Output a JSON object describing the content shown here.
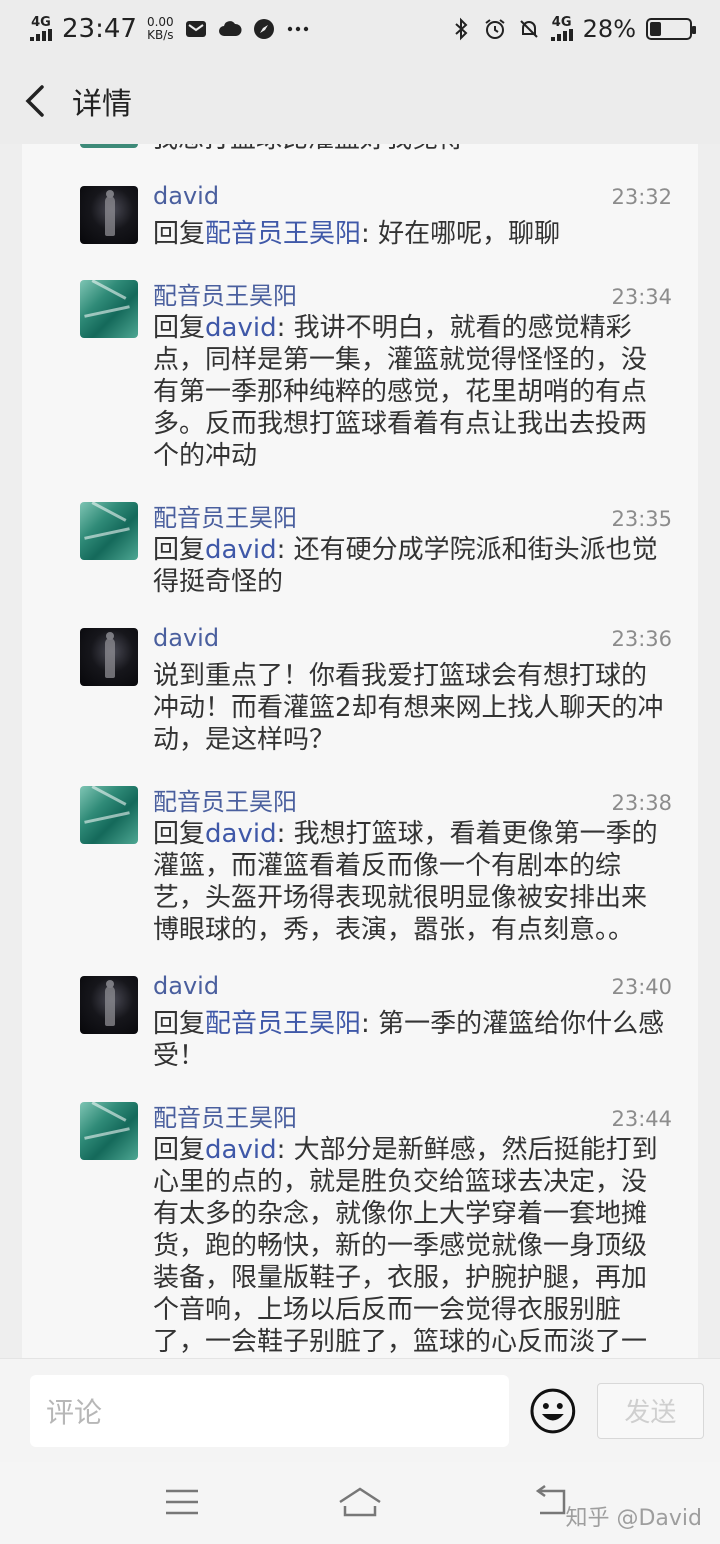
{
  "status_bar": {
    "network": "4G",
    "time": "23:47",
    "speed_value": "0.00",
    "speed_unit": "KB/s",
    "network_right": "4G",
    "battery": "28%",
    "battery_level": 0.28
  },
  "header": {
    "title": "详情"
  },
  "cutoff_text": "我想打篮球比灌篮好我觉得",
  "messages": [
    {
      "user": "david",
      "time": "23:32",
      "reply_prefix": "回复",
      "reply_to": "配音员王昊阳",
      "sep": ": ",
      "text": "好在哪呢，聊聊",
      "avatar": "dark"
    },
    {
      "user": "配音员王昊阳",
      "time": "23:34",
      "reply_prefix": "回复",
      "reply_to": "david",
      "sep": ": ",
      "text": "我讲不明白，就看的感觉精彩点，同样是第一集，灌篮就觉得怪怪的，没有第一季那种纯粹的感觉，花里胡哨的有点多。反而我想打篮球看着有点让我出去投两个的冲动",
      "avatar": "teal"
    },
    {
      "user": "配音员王昊阳",
      "time": "23:35",
      "reply_prefix": "回复",
      "reply_to": "david",
      "sep": ": ",
      "text": "还有硬分成学院派和街头派也觉得挺奇怪的",
      "avatar": "teal"
    },
    {
      "user": "david",
      "time": "23:36",
      "reply_prefix": "",
      "reply_to": "",
      "sep": "",
      "text": "说到重点了！你看我爱打篮球会有想打球的冲动！而看灌篮2却有想来网上找人聊天的冲动，是这样吗？",
      "avatar": "dark"
    },
    {
      "user": "配音员王昊阳",
      "time": "23:38",
      "reply_prefix": "回复",
      "reply_to": "david",
      "sep": ": ",
      "text": "我想打篮球，看着更像第一季的灌篮，而灌篮看着反而像一个有剧本的综艺，头盔开场得表现就很明显像被安排出来博眼球的，秀，表演，嚣张，有点刻意。。",
      "avatar": "teal"
    },
    {
      "user": "david",
      "time": "23:40",
      "reply_prefix": "回复",
      "reply_to": "配音员王昊阳",
      "sep": ": ",
      "text": "第一季的灌篮给你什么感受！",
      "avatar": "dark"
    },
    {
      "user": "配音员王昊阳",
      "time": "23:44",
      "reply_prefix": "回复",
      "reply_to": "david",
      "sep": ": ",
      "text": "大部分是新鲜感，然后挺能打到心里的点的，就是胜负交给篮球去决定，没有太多的杂念，就像你上大学穿着一套地摊货，跑的畅快，新的一季感觉就像一身顶级装备，限量版鞋子，衣服，护腕护腿，再加个音响，上场以后反而一会觉得衣服别脏了，一会鞋子别脏了，篮球的心反而淡了一",
      "avatar": "teal"
    }
  ],
  "footer": {
    "comment_placeholder": "评论",
    "send_label": "发送"
  },
  "watermark": "知乎 @David"
}
